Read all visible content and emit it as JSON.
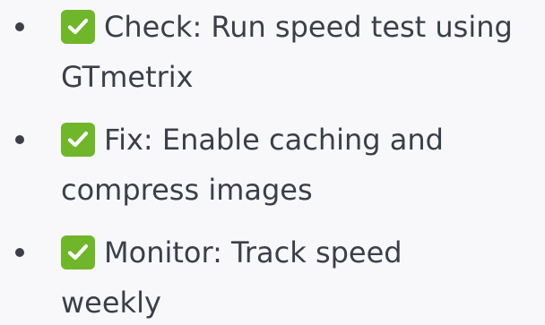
{
  "items": [
    {
      "icon": "check-mark-icon",
      "line1": "Check: Run speed test using",
      "line2": "GTmetrix"
    },
    {
      "icon": "check-mark-icon",
      "line1": "Fix: Enable caching and",
      "line2": "compress images"
    },
    {
      "icon": "check-mark-icon",
      "line1": "Monitor: Track speed",
      "line2": "weekly"
    }
  ],
  "colors": {
    "background": "#f8f8fb",
    "text": "#3b3f4a",
    "check_box": "#70b62b",
    "check_mark": "#ffffff"
  }
}
